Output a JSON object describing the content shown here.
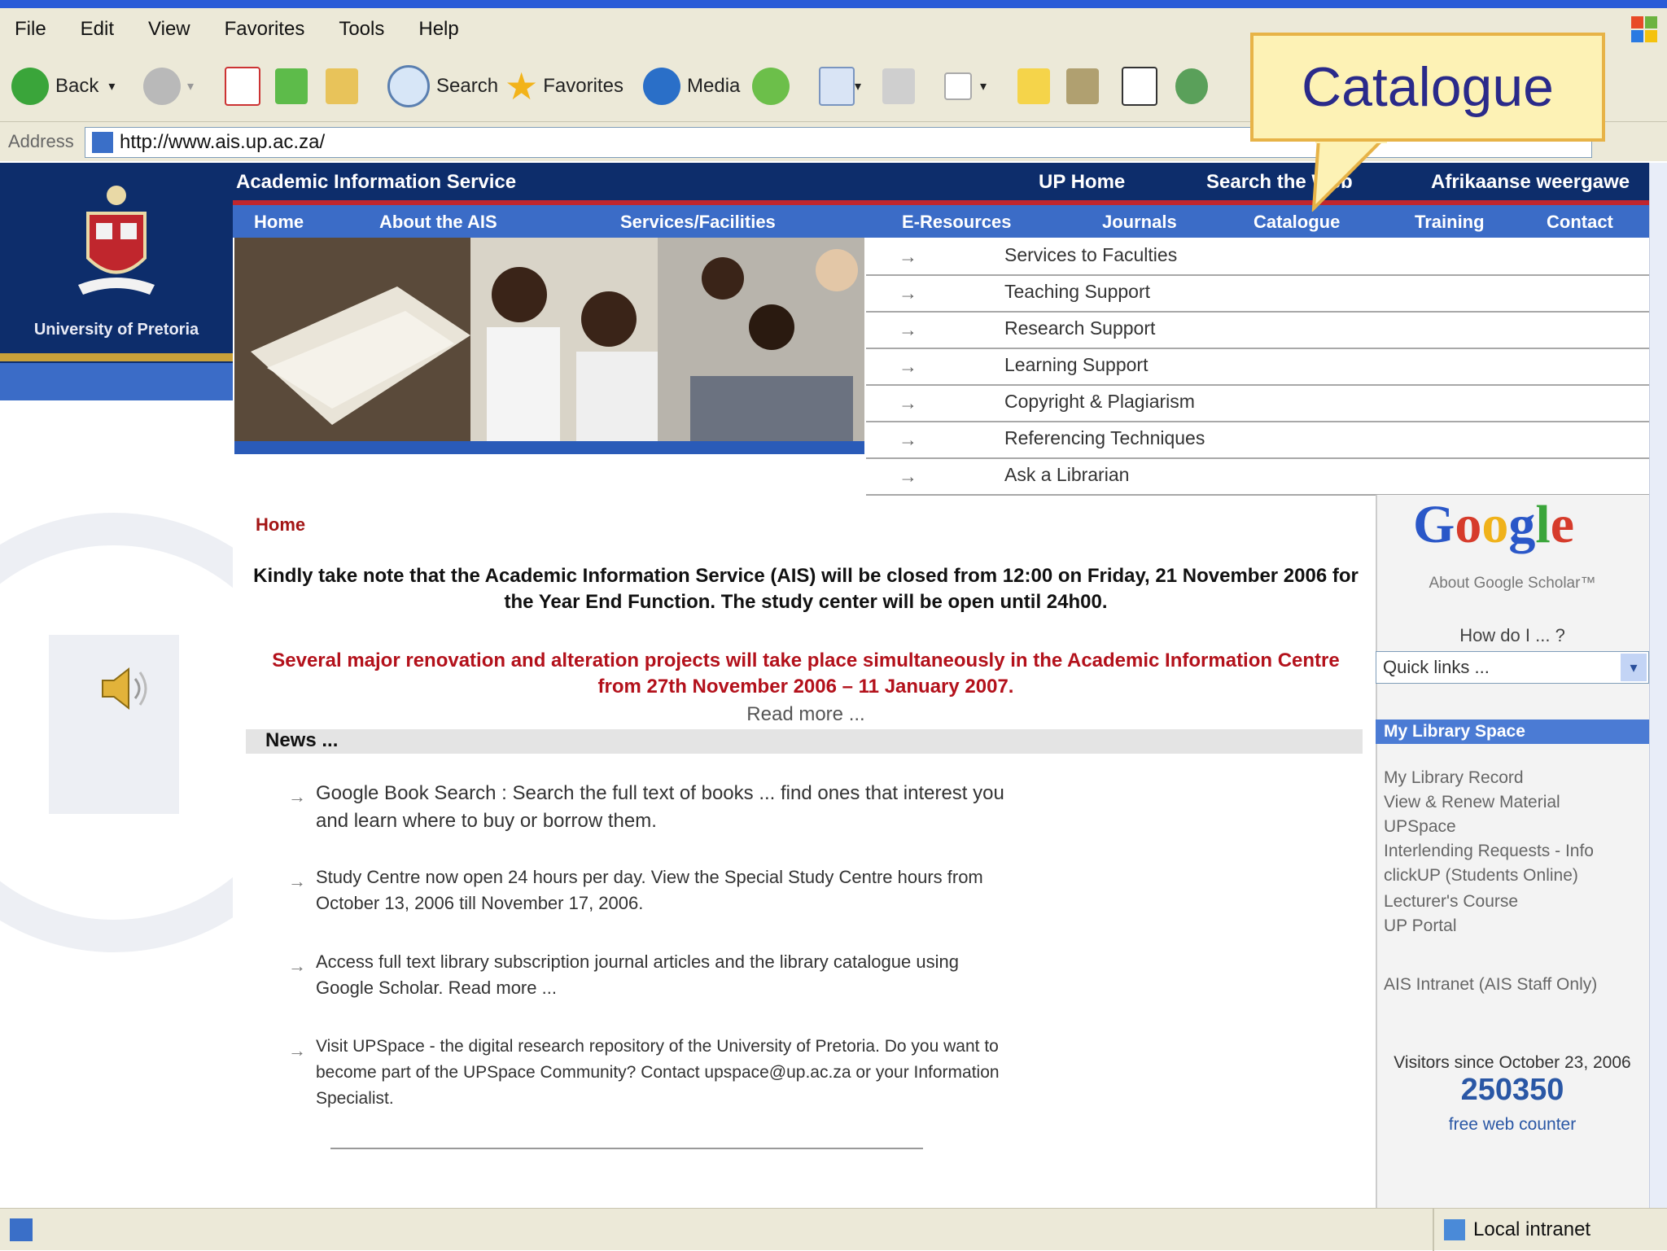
{
  "menubar": {
    "items": [
      "File",
      "Edit",
      "View",
      "Favorites",
      "Tools",
      "Help"
    ]
  },
  "toolbar": {
    "back": "Back",
    "search": "Search",
    "favorites": "Favorites",
    "media": "Media"
  },
  "address": {
    "label": "Address",
    "url": "http://www.ais.up.ac.za/"
  },
  "callout": {
    "text": "Catalogue"
  },
  "site": {
    "university": "University of Pretoria",
    "top_nav": {
      "title": "Academic Information Service",
      "up_home": "UP Home",
      "search": "Search the Web",
      "afrikaans": "Afrikaanse weergawe"
    },
    "main_nav": [
      "Home",
      "About the AIS",
      "Services/Facilities",
      "E-Resources",
      "Journals",
      "Catalogue",
      "Training",
      "Contact"
    ],
    "dropdown": [
      "Services to Faculties",
      "Teaching Support",
      "Research Support",
      "Learning Support",
      "Copyright & Plagiarism",
      "Referencing Techniques",
      "Ask a Librarian"
    ],
    "breadcrumb": "Home",
    "notice": "Kindly take note that the Academic Information Service (AIS) will be closed from 12:00 on Friday, 21 November 2006 for the Year End Function. The study center will be open until 24h00.",
    "renovation": "Several major renovation and alteration projects will take place simultaneously in the Academic Information Centre from 27th November 2006 – 11 January 2007.",
    "read_more": "Read more ...",
    "news_heading": "News ...",
    "news": [
      "Google Book Search : Search the full text of books ... find ones that interest you and learn where to buy or borrow them.",
      "Study Centre now open 24 hours per day. View the Special Study Centre hours from October 13, 2006 till November 17, 2006.",
      "Access full text library subscription journal articles and the library catalogue using Google Scholar. Read more ...",
      "Visit UPSpace - the digital research repository of the University of Pretoria. Do you want to become part of the UPSpace Community? Contact upspace@up.ac.za or your Information Specialist."
    ],
    "sidebar": {
      "about_gs": "About Google Scholar™",
      "howdo": "How do I ... ?",
      "quick_links": "Quick links ...",
      "mylib_title": "My Library Space",
      "mylib_links": [
        "My Library Record",
        "View & Renew Material",
        "UPSpace",
        "Interlending Requests - Info",
        "clickUP (Students Online)",
        "Lecturer's Course",
        "UP Portal"
      ],
      "ais_intranet": "AIS Intranet (AIS Staff Only)",
      "visitors_label": "Visitors since October 23, 2006",
      "visitor_count": "250350",
      "free_counter": "free web counter"
    }
  },
  "status": {
    "zone": "Local intranet"
  },
  "colors": {
    "navy": "#0d2d6b",
    "nav_blue": "#3b6cc7",
    "red": "#b3111b",
    "gold": "#c9a13a"
  }
}
